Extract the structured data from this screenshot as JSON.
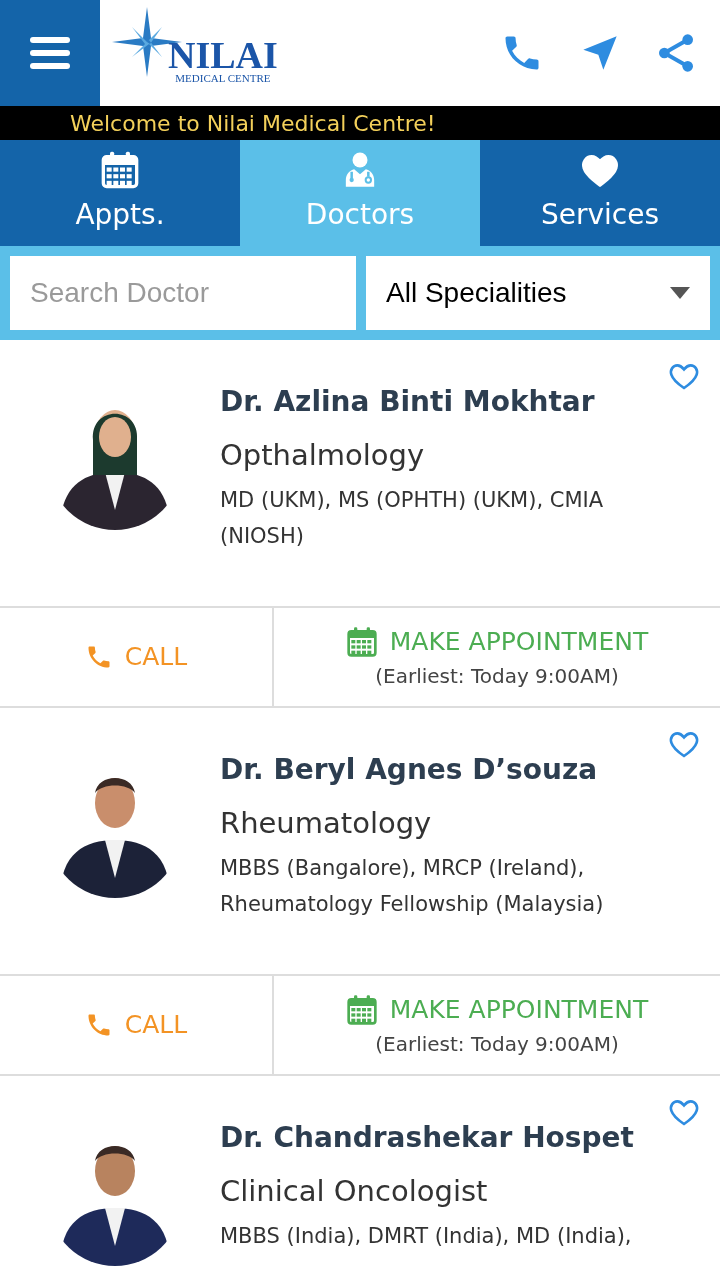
{
  "header": {
    "logo_name": "NILAI",
    "logo_subtitle": "MEDICAL CENTRE"
  },
  "welcome": "Welcome to Nilai Medical Centre!",
  "tabs": [
    {
      "kind": "calendar",
      "label": "Appts.",
      "selected": false
    },
    {
      "kind": "doctor",
      "label": "Doctors",
      "selected": true
    },
    {
      "kind": "heart",
      "label": "Services",
      "selected": false
    }
  ],
  "search": {
    "placeholder": "Search Doctor"
  },
  "speciality_select": {
    "value": "All Specialities"
  },
  "doctors": [
    {
      "name": "Dr. Azlina Binti Mokhtar",
      "speciality": "Opthalmology",
      "credentials": "MD (UKM), MS (OPHTH) (UKM), CMIA (NIOSH)",
      "favorite": false,
      "call": "CALL",
      "appointment": "MAKE APPOINTMENT",
      "earliest": "(Earliest: Today 9:00AM)"
    },
    {
      "name": "Dr. Beryl Agnes D’souza",
      "speciality": "Rheumatology",
      "credentials": "MBBS (Bangalore), MRCP (Ireland), Rheumatology Fellowship (Malaysia)",
      "favorite": false,
      "call": "CALL",
      "appointment": "MAKE APPOINTMENT",
      "earliest": "(Earliest: Today 9:00AM)"
    },
    {
      "name": "Dr. Chandrashekar Hospet",
      "speciality": "Clinical Oncologist",
      "credentials": "MBBS (India), DMRT (India), MD (India),",
      "favorite": false
    }
  ]
}
